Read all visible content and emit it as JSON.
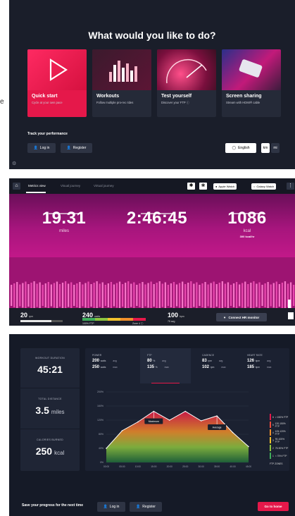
{
  "home": {
    "title": "What would you like to do?",
    "cards": [
      {
        "title": "Quick start",
        "subtitle": "Cycle at your own pace"
      },
      {
        "title": "Workouts",
        "subtitle": "Follow multiple pro-rec rides"
      },
      {
        "title": "Test yourself",
        "subtitle": "Discover your FTP ⓘ"
      },
      {
        "title": "Screen sharing",
        "subtitle": "Stream with HDMI® cable"
      }
    ],
    "track_label": "Track your performance",
    "login_label": "Log in",
    "register_label": "Register",
    "language_label": "English",
    "units": [
      "km",
      "mi"
    ],
    "side_text": "e"
  },
  "ride": {
    "tabs": [
      "Metrics view",
      "Visual journey",
      "Virtual journey"
    ],
    "bluetooth_icon": "bluetooth-icon",
    "apple_watch": "Apple Watch",
    "galaxy_watch_top": "Samsung",
    "galaxy_watch": "Galaxy Watch",
    "distance": {
      "value": "19.31",
      "unit": "miles"
    },
    "time": {
      "value": "2:46:45"
    },
    "calories": {
      "value": "1086",
      "unit": "kcal",
      "sub": "300 kcal/hr"
    },
    "cadence": {
      "value": "20",
      "unit": "rpm"
    },
    "power": {
      "value": "240",
      "unit": "watts",
      "left": "100% FTP",
      "right": "Zone 4 ⓘ"
    },
    "heart": {
      "value": "100",
      "unit": "bpm",
      "sub": "75 avg"
    },
    "connect_label": "Connect HR monitor"
  },
  "summary": {
    "items": [
      {
        "label": "WORKOUT DURATION",
        "value": "45:21",
        "unit": ""
      },
      {
        "label": "TOTAL DISTANCE",
        "value": "3.5",
        "unit": "miles"
      },
      {
        "label": "CALORIES BURNED",
        "value": "250",
        "unit": "kcal"
      }
    ],
    "metrics": [
      {
        "title": "POWER",
        "rows": [
          {
            "v": "200",
            "u": "watts",
            "k": "avg"
          },
          {
            "v": "250",
            "u": "watts",
            "k": "max"
          }
        ]
      },
      {
        "title": "FTP",
        "rows": [
          {
            "v": "80",
            "u": "%",
            "k": "avg"
          },
          {
            "v": "135",
            "u": "%",
            "k": "max"
          }
        ]
      },
      {
        "title": "CADENCE",
        "rows": [
          {
            "v": "83",
            "u": "rpm",
            "k": "avg"
          },
          {
            "v": "102",
            "u": "rpm",
            "k": "max"
          }
        ]
      },
      {
        "title": "HEART RATE",
        "rows": [
          {
            "v": "126",
            "u": "bpm",
            "k": "avg"
          },
          {
            "v": "185",
            "u": "bpm",
            "k": "max"
          }
        ]
      }
    ],
    "annotations": {
      "peak": "Maximum",
      "avg": "Average"
    },
    "legend_title": "FTP ZONES",
    "legend": [
      {
        "zone": "6",
        "label": "> 150% FTP",
        "color": "#e5184a"
      },
      {
        "zone": "5",
        "label": "120-150% FTP",
        "color": "#ef4a3c"
      },
      {
        "zone": "4",
        "label": "105-120% FTP",
        "color": "#f08f2a"
      },
      {
        "zone": "3",
        "label": "90-105% FTP",
        "color": "#f2c22d"
      },
      {
        "zone": "2",
        "label": "75-90% FTP",
        "color": "#8dc43f"
      },
      {
        "zone": "1",
        "label": "< 75% FTP",
        "color": "#3fae5b"
      }
    ],
    "save_text": "Save your progress for the next time",
    "login_label": "Log in",
    "register_label": "Register",
    "home_label": "Go to home",
    "colors": {
      "accent": "#e5184a",
      "panel": "#1b1f2b"
    }
  },
  "chart_data": {
    "type": "area",
    "x": [
      "00:00",
      "05:00",
      "10:00",
      "15:00",
      "20:00",
      "25:00",
      "30:00",
      "35:00",
      "40:00",
      "45:00"
    ],
    "series": [
      {
        "values": [
          40,
          90,
          115,
          145,
          120,
          145,
          118,
          132,
          85,
          45
        ]
      }
    ],
    "ylim": [
      0,
      200
    ],
    "yticks": [
      "200%",
      "160%",
      "120%",
      "80%",
      "40%",
      "0%"
    ],
    "grid": true
  }
}
